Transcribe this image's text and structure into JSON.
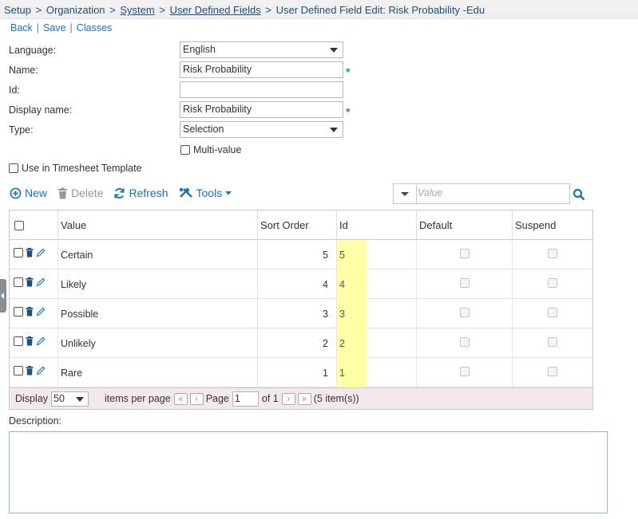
{
  "breadcrumb": {
    "items": [
      "Setup",
      "Organization",
      "System",
      "User Defined Fields",
      "User Defined Field Edit: Risk Probability -Edu"
    ],
    "separator": ">"
  },
  "actions": {
    "back": "Back",
    "save": "Save",
    "classes": "Classes",
    "divider": "|"
  },
  "form": {
    "language_label": "Language:",
    "language_value": "English",
    "name_label": "Name:",
    "name_value": "Risk Probability",
    "id_label": "Id:",
    "id_value": "",
    "display_name_label": "Display name:",
    "display_name_value": "Risk Probability",
    "type_label": "Type:",
    "type_value": "Selection",
    "required_mark": "*",
    "multi_value_label": "Multi-value",
    "use_in_timesheet_label": "Use in Timesheet Template"
  },
  "toolbar": {
    "new": "New",
    "delete": "Delete",
    "refresh": "Refresh",
    "tools": "Tools"
  },
  "filter": {
    "placeholder": "Value"
  },
  "grid": {
    "columns": [
      "Value",
      "Sort Order",
      "Id",
      "Default",
      "Suspend"
    ],
    "rows": [
      {
        "value": "Certain",
        "sort_order": "5",
        "id": "5"
      },
      {
        "value": "Likely",
        "sort_order": "4",
        "id": "4"
      },
      {
        "value": "Possible",
        "sort_order": "3",
        "id": "3"
      },
      {
        "value": "Unlikely",
        "sort_order": "2",
        "id": "2"
      },
      {
        "value": "Rare",
        "sort_order": "1",
        "id": "1"
      }
    ]
  },
  "pager": {
    "display_label": "Display",
    "page_size": "50",
    "items_per_page": "items per page",
    "page_label": "Page",
    "page": "1",
    "of_label": "of 1",
    "count": "(5 item(s))"
  },
  "description": {
    "label": "Description:"
  },
  "colors": {
    "link": "#1a73b5",
    "highlight": "#ffffa6",
    "pager_bg": "#f3e9ec"
  }
}
